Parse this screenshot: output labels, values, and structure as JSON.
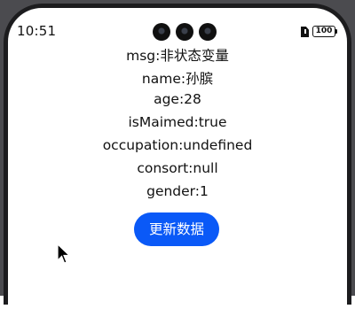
{
  "status_bar": {
    "time": "10:51",
    "battery": "100"
  },
  "fields": [
    {
      "label": "msg:非状态变量"
    },
    {
      "label": "name:孙膑"
    },
    {
      "label": "age:28"
    },
    {
      "label": "isMaimed:true"
    },
    {
      "label": "occupation:undefined"
    },
    {
      "label": "consort:null"
    },
    {
      "label": "gender:1"
    }
  ],
  "update_button": {
    "label": "更新数据"
  },
  "colors": {
    "accent": "#0a59f7",
    "text": "#111111",
    "background": "#ffffff",
    "bezel": "#4b4b4f"
  },
  "icons": [
    "sim-alert-icon",
    "battery-icon",
    "camera-icon",
    "mouse-cursor-icon"
  ]
}
